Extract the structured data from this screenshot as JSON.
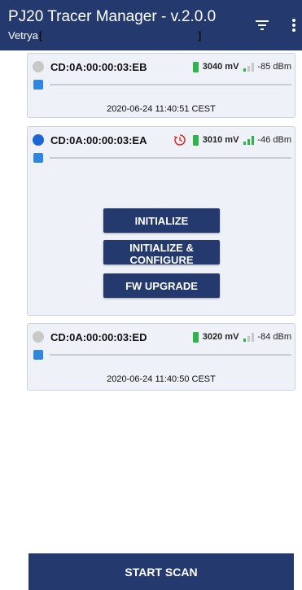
{
  "app": {
    "title": "PJ20 Tracer Manager - v.2.0.0",
    "subtitle": "Vetrya",
    "bracket_open": "[",
    "bracket_close": "]",
    "colors": {
      "appbar": "#243a6e",
      "card_bg": "#eef1f7",
      "active_dot": "#1e66d6",
      "battery": "#2fb34a",
      "history": "#d9302a"
    }
  },
  "devices": [
    {
      "mac": "CD:0A:00:00:03:EB",
      "voltage": "3040 mV",
      "rssi": "-85 dBm",
      "timestamp": "2020-06-24 11:40:51 CEST",
      "active": false
    },
    {
      "mac": "CD:0A:00:00:03:EA",
      "voltage": "3010 mV",
      "rssi": "-46 dBm",
      "active": true,
      "icons": [
        "history-icon"
      ],
      "actions": {
        "initialize": "INITIALIZE",
        "initialize_configure": "INITIALIZE & CONFIGURE",
        "fw_upgrade": "FW UPGRADE"
      }
    },
    {
      "mac": "CD:0A:00:00:03:ED",
      "voltage": "3020 mV",
      "rssi": "-84 dBm",
      "timestamp": "2020-06-24 11:40:50 CEST",
      "active": false
    }
  ],
  "footer": {
    "scan_label": "START SCAN"
  }
}
